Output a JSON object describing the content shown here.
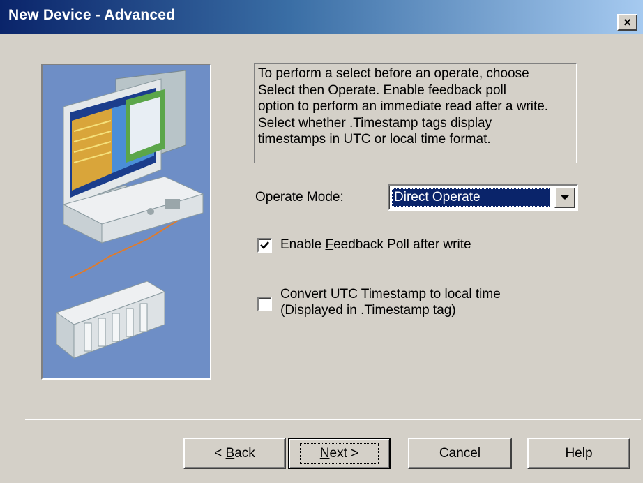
{
  "colors": {
    "titlebar_start": "#0a246a",
    "titlebar_end": "#a6caf0",
    "dialog_bg": "#d4d0c8",
    "selection_bg": "#0a246a",
    "illustration_bg": "#6e8ec6"
  },
  "window": {
    "title": "New Device - Advanced",
    "close_symbol": "×"
  },
  "info": {
    "lines": [
      "To perform a select before an operate, choose",
      "Select then Operate. Enable feedback poll",
      "option to perform an immediate read after a write.",
      "Select whether .Timestamp tags display",
      "timestamps in UTC or local time format."
    ]
  },
  "operate_mode": {
    "label_hotkey": "O",
    "label_rest": "perate Mode:",
    "selected": "Direct Operate"
  },
  "options": {
    "feedback": {
      "label_pre": "Enable ",
      "label_hotkey": "F",
      "label_post": "eedback Poll after write",
      "checked": true,
      "check_mark": "✓"
    },
    "utc": {
      "line1_pre": "Convert ",
      "line1_hotkey": "U",
      "line1_post": "TC Timestamp to local time",
      "line2": "(Displayed in .Timestamp tag)",
      "checked": false
    }
  },
  "buttons": {
    "back_prefix": "< ",
    "back_hotkey": "B",
    "back_rest": "ack",
    "next_hotkey": "N",
    "next_rest": "ext >",
    "cancel": "Cancel",
    "help": "Help"
  }
}
